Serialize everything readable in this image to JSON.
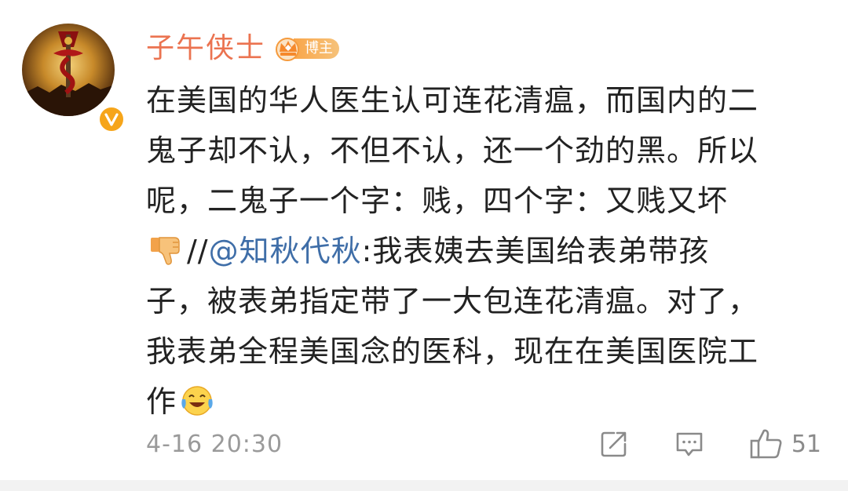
{
  "comment": {
    "username": "子午侠士",
    "poster_badge": "博主",
    "lines": [
      "在美国的华人医生认可连花清瘟，而国内的二",
      "鬼子却不认，不但不认，还一个劲的黑。所以",
      "呢，二鬼子一个字：贱，四个字：又贱又坏"
    ],
    "repost_separator": "//",
    "mention": "@知秋代秋",
    "quoted_text_line1": ":我表姨去美国给表弟带孩",
    "quoted_lines": [
      "子，被表弟指定带了一大包连花清瘟。对了，",
      "我表弟全程美国念的医科，现在在美国医院工"
    ],
    "quoted_last_line": "作",
    "timestamp": "4-16 20:30",
    "like_count": "51",
    "icons": {
      "thumbs_down": "thumbs-down-emoji",
      "laugh_cry": "laughing-crying-emoji",
      "share": "share-icon",
      "comment": "comment-icon",
      "like": "like-icon"
    },
    "colors": {
      "username": "#eb7350",
      "mention": "#3f6ea8",
      "timestamp": "#9a9a9a",
      "badge": "#f6a51a"
    }
  }
}
